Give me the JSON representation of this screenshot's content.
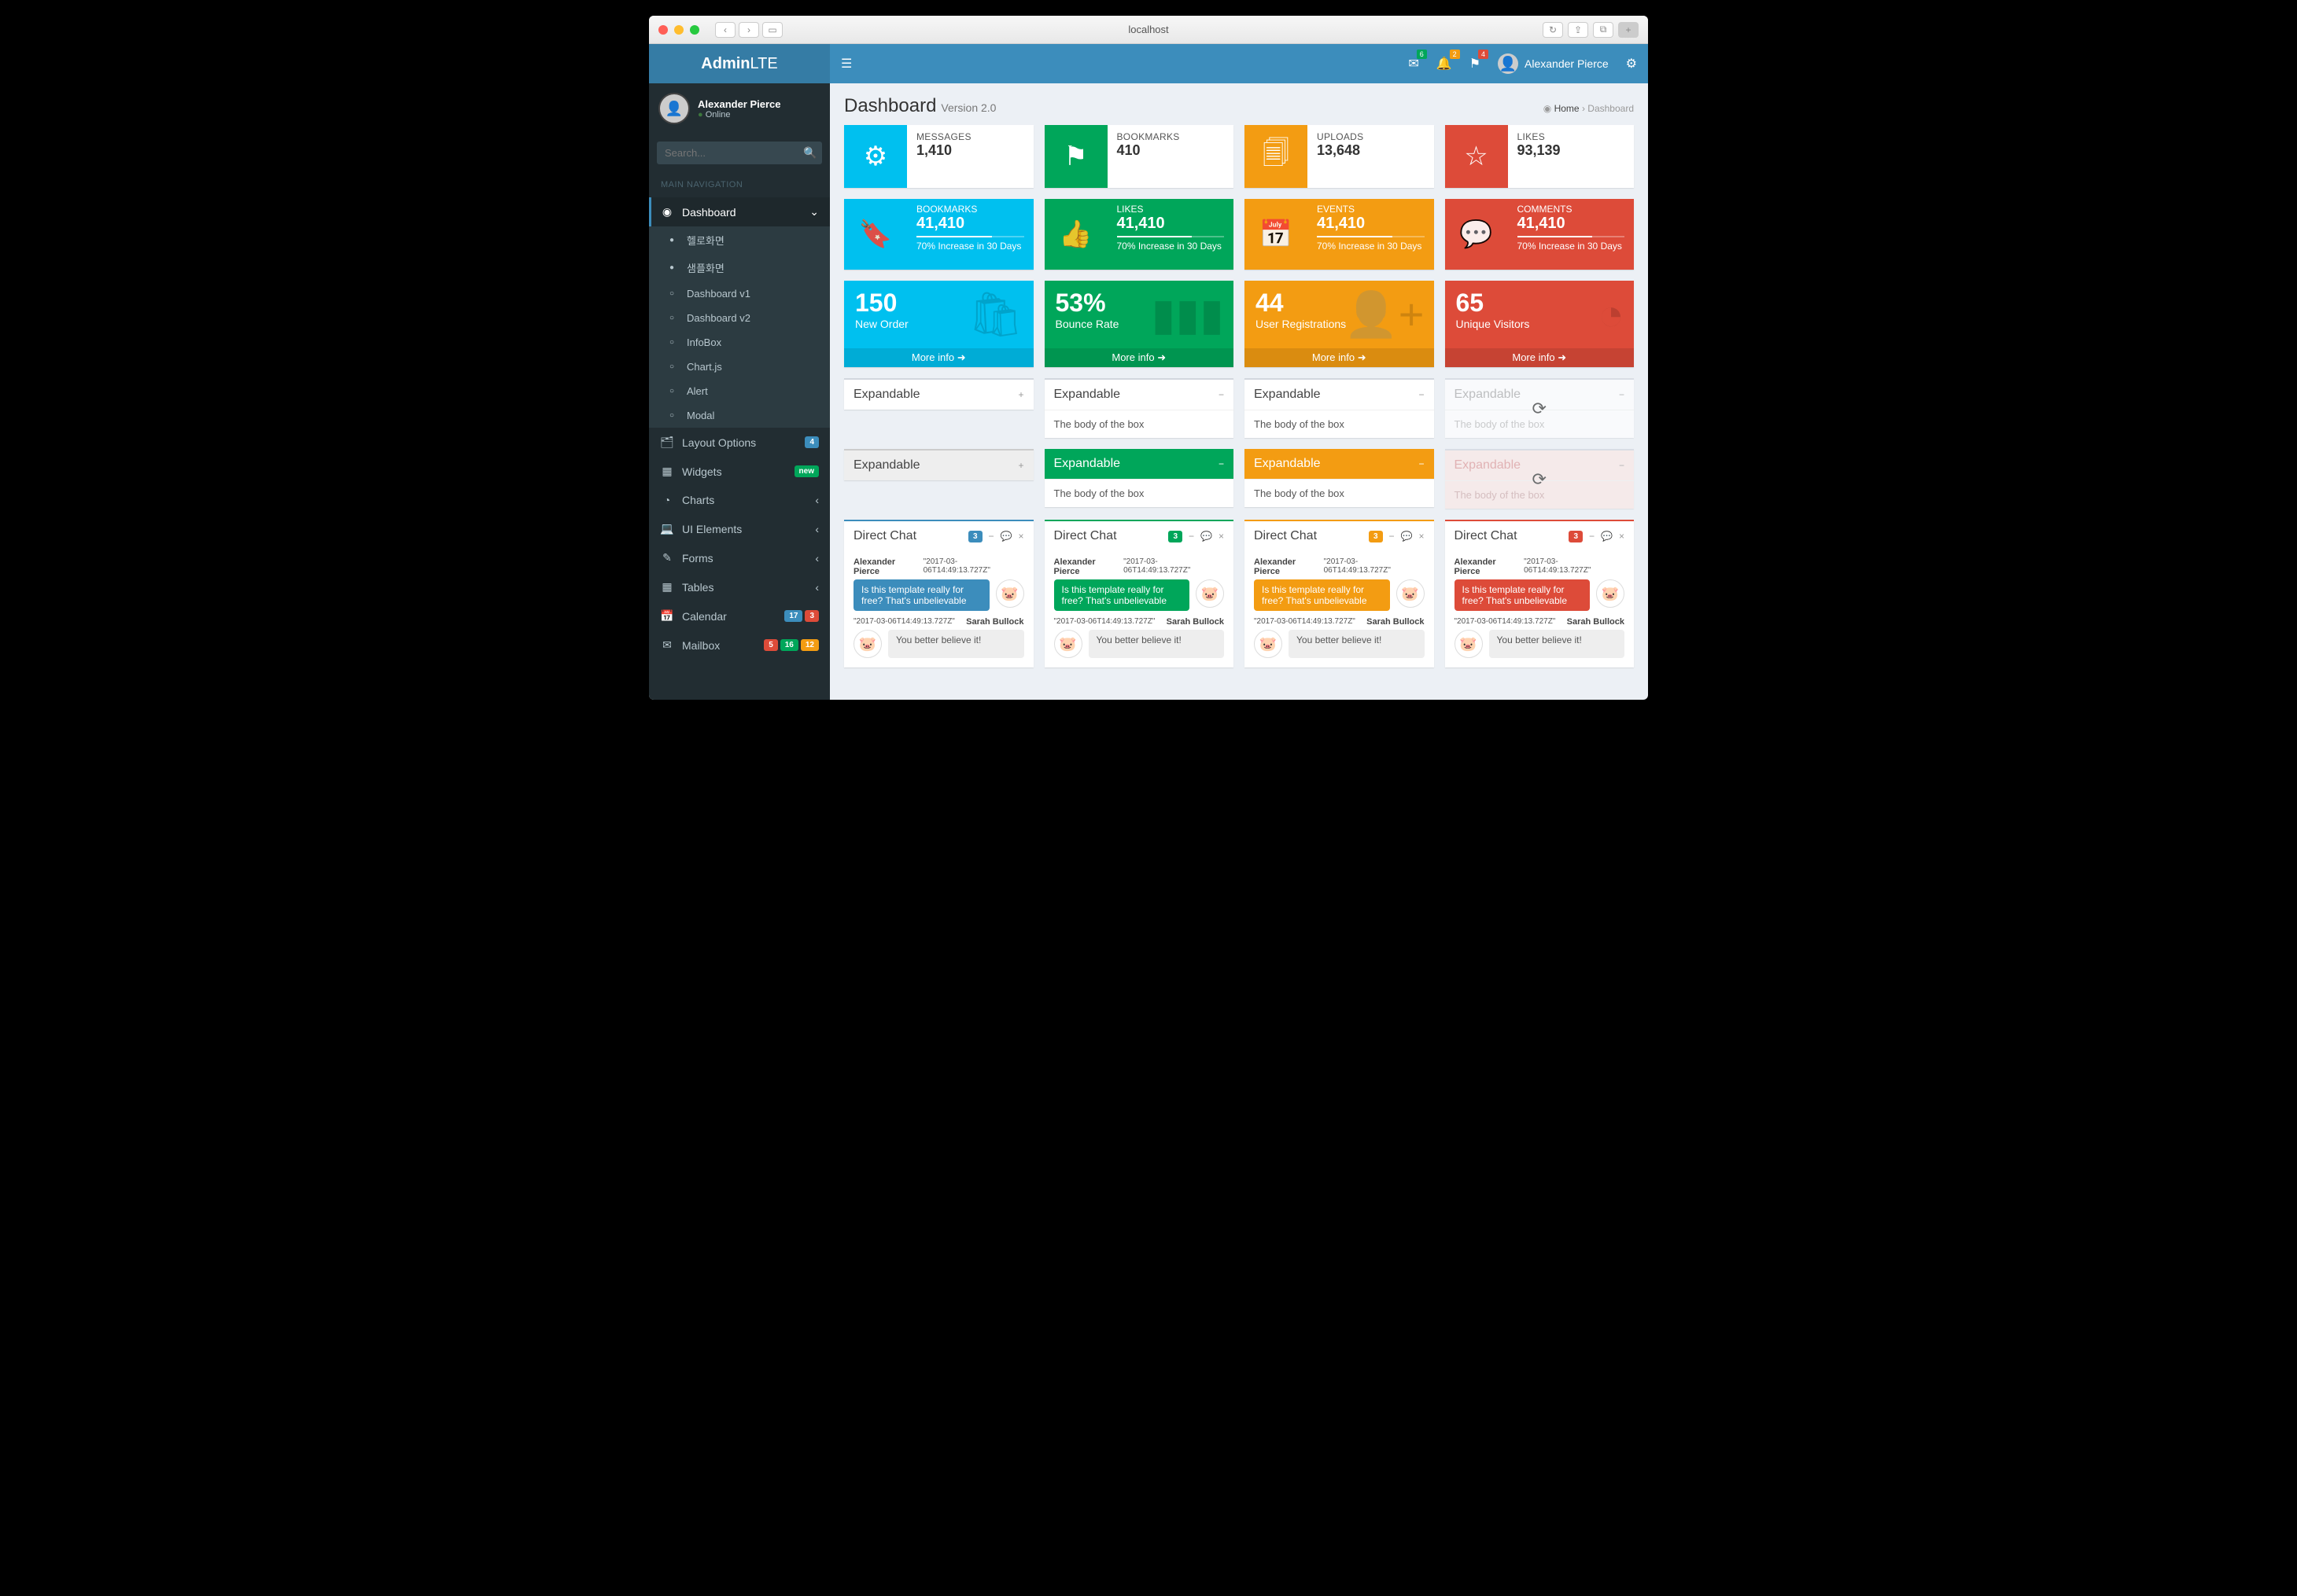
{
  "browser": {
    "url": "localhost"
  },
  "brand": {
    "bold": "Admin",
    "light": "LTE"
  },
  "user": {
    "name": "Alexander Pierce",
    "status": "Online"
  },
  "search": {
    "placeholder": "Search..."
  },
  "sidebar": {
    "header": "MAIN NAVIGATION",
    "dashboard": "Dashboard",
    "sub": [
      "헬로화면",
      "샘플화면",
      "Dashboard v1",
      "Dashboard v2",
      "InfoBox",
      "Chart.js",
      "Alert",
      "Modal"
    ],
    "layout": "Layout Options",
    "layout_badge": "4",
    "widgets": "Widgets",
    "widgets_badge": "new",
    "charts": "Charts",
    "ui": "UI Elements",
    "forms": "Forms",
    "tables": "Tables",
    "calendar": "Calendar",
    "calendar_b1": "17",
    "calendar_b2": "3",
    "mailbox": "Mailbox",
    "mailbox_b1": "5",
    "mailbox_b2": "16",
    "mailbox_b3": "12"
  },
  "topbar": {
    "mail_badge": "6",
    "bell_badge": "2",
    "flag_badge": "4"
  },
  "header": {
    "title": "Dashboard",
    "subtitle": "Version 2.0",
    "breadcrumb_home": "Home",
    "breadcrumb_current": "Dashboard"
  },
  "info1": [
    {
      "label": "MESSAGES",
      "value": "1,410"
    },
    {
      "label": "BOOKMARKS",
      "value": "410"
    },
    {
      "label": "UPLOADS",
      "value": "13,648"
    },
    {
      "label": "LIKES",
      "value": "93,139"
    }
  ],
  "info2": [
    {
      "label": "BOOKMARKS",
      "value": "41,410",
      "desc": "70% Increase in 30 Days"
    },
    {
      "label": "LIKES",
      "value": "41,410",
      "desc": "70% Increase in 30 Days"
    },
    {
      "label": "EVENTS",
      "value": "41,410",
      "desc": "70% Increase in 30 Days"
    },
    {
      "label": "COMMENTS",
      "value": "41,410",
      "desc": "70% Increase in 30 Days"
    }
  ],
  "small": [
    {
      "value": "150",
      "label": "New Order",
      "more": "More info"
    },
    {
      "value": "53%",
      "label": "Bounce Rate",
      "more": "More info"
    },
    {
      "value": "44",
      "label": "User Registrations",
      "more": "More info"
    },
    {
      "value": "65",
      "label": "Unique Visitors",
      "more": "More info"
    }
  ],
  "exp": {
    "title": "Expandable",
    "body": "The body of the box"
  },
  "chat": {
    "title": "Direct Chat",
    "badge": "3",
    "sender": "Alexander Pierce",
    "time1": "\"2017-03-06T14:49:13.727Z\"",
    "msg1": "Is this template really for free? That's unbelievable",
    "time2": "\"2017-03-06T14:49:13.727Z\"",
    "replier": "Sarah Bullock",
    "msg2": "You better believe it!"
  }
}
